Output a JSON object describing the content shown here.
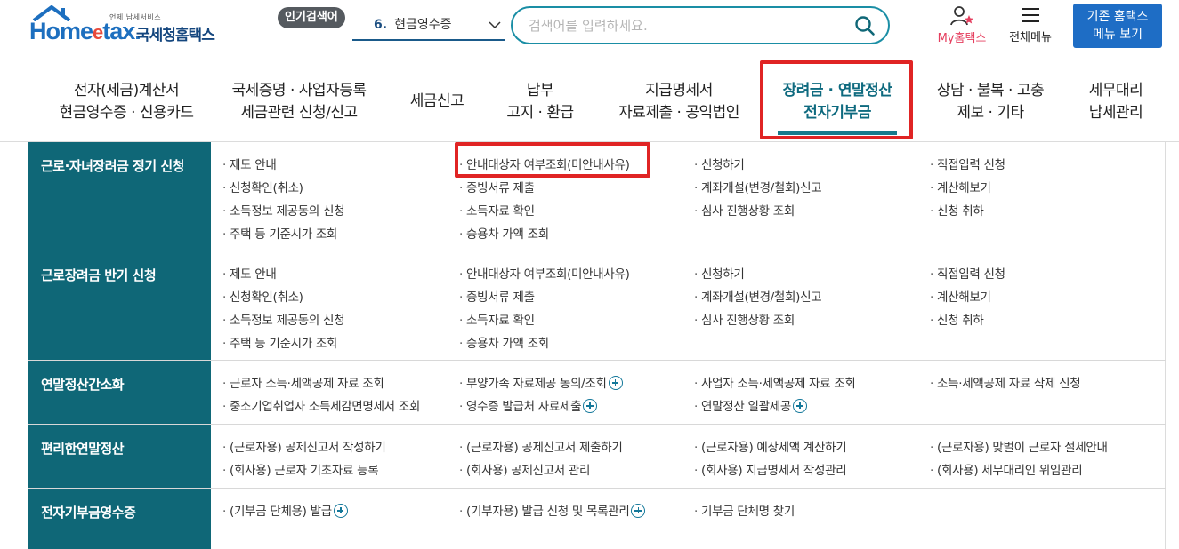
{
  "header": {
    "logo": {
      "small_text": "언제 납세서비스",
      "mark": "Home",
      "mark_e": "e",
      "mark_tail": "tax.",
      "korean": "국세청홈택스"
    },
    "popular_badge": "인기검색어",
    "popular_rank": "6.",
    "popular_term": "현금영수증",
    "search_placeholder": "검색어를 입력하세요.",
    "mytax_label": "My홈택스",
    "allmenu_label": "전체메뉴",
    "legacy_line1": "기존 홈택스",
    "legacy_line2": "메뉴 보기"
  },
  "nav": [
    {
      "l1": "전자(세금)계산서",
      "l2": "현금영수증 · 신용카드"
    },
    {
      "l1": "국세증명 · 사업자등록",
      "l2": "세금관련 신청/신고"
    },
    {
      "l1": "세금신고",
      "l2": ""
    },
    {
      "l1": "납부",
      "l2": "고지 · 환급"
    },
    {
      "l1": "지급명세서",
      "l2": "자료제출 · 공익법인"
    },
    {
      "l1": "장려금 · 연말정산",
      "l2": "전자기부금",
      "active": true
    },
    {
      "l1": "상담 · 불복 · 고충",
      "l2": "제보 · 기타"
    },
    {
      "l1": "세무대리",
      "l2": "납세관리"
    }
  ],
  "menu": [
    {
      "title": "근로·자녀장려금 정기 신청",
      "links": [
        [
          "제도 안내",
          "안내대상자 여부조회(미안내사유)",
          "신청하기",
          "직접입력 신청"
        ],
        [
          "신청확인(취소)",
          "증빙서류 제출",
          "계좌개설(변경/철회)신고",
          "계산해보기"
        ],
        [
          "소득정보 제공동의 신청",
          "소득자료 확인",
          "심사 진행상황 조회",
          "신청 취하"
        ],
        [
          "주택 등 기준시가 조회",
          "승용차 가액 조회",
          "",
          ""
        ]
      ]
    },
    {
      "title": "근로장려금 반기 신청",
      "links": [
        [
          "제도 안내",
          "안내대상자 여부조회(미안내사유)",
          "신청하기",
          "직접입력 신청"
        ],
        [
          "신청확인(취소)",
          "증빙서류 제출",
          "계좌개설(변경/철회)신고",
          "계산해보기"
        ],
        [
          "소득정보 제공동의 신청",
          "소득자료 확인",
          "심사 진행상황 조회",
          "신청 취하"
        ],
        [
          "주택 등 기준시가 조회",
          "승용차 가액 조회",
          "",
          ""
        ]
      ]
    },
    {
      "title": "연말정산간소화",
      "links": [
        [
          "근로자 소득·세액공제 자료 조회",
          "부양가족 자료제공 동의/조회",
          "사업자 소득·세액공제 자료 조회",
          "소득·세액공제 자료 삭제 신청"
        ],
        [
          "중소기업취업자 소득세감면명세서 조회",
          "영수증 발급처 자료제출",
          "연말정산 일괄제공",
          ""
        ]
      ]
    },
    {
      "title": "편리한연말정산",
      "links": [
        [
          "(근로자용) 공제신고서 작성하기",
          "(근로자용) 공제신고서 제출하기",
          "(근로자용) 예상세액 계산하기",
          "(근로자용) 맞벌이 근로자 절세안내"
        ],
        [
          "(회사용) 근로자 기초자료 등록",
          "(회사용) 공제신고서 관리",
          "(회사용) 지급명세서 작성관리",
          "(회사용) 세무대리인 위임관리"
        ]
      ]
    },
    {
      "title": "전자기부금영수증",
      "links": [
        [
          "(기부금 단체용) 발급",
          "(기부자용) 발급 신청 및 목록관리",
          "기부금 단체명 찾기",
          ""
        ]
      ]
    }
  ]
}
